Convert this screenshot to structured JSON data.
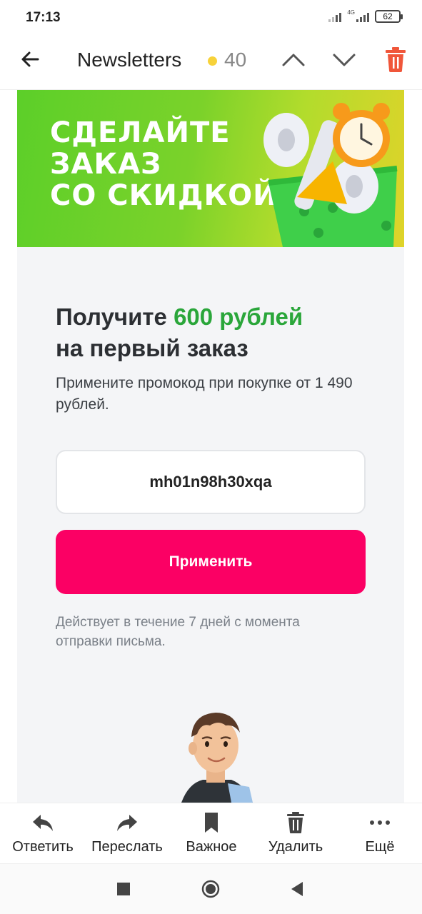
{
  "status_bar": {
    "time": "17:13",
    "network": "4G",
    "battery": "62"
  },
  "header": {
    "title": "Newsletters",
    "unread_count": "40",
    "unread_dot_color": "#f7d23a"
  },
  "banner": {
    "lines": [
      "СДЕЛАЙТЕ",
      "ЗАКАЗ",
      "СО СКИДКОЙ"
    ]
  },
  "promo": {
    "title_prefix": "Получите ",
    "title_accent": "600 рублей",
    "title_suffix": "на первый заказ",
    "description": "Примените промокод при покупке от 1 490 рублей.",
    "code": "mh01n98h30xqa",
    "apply_label": "Применить",
    "validity_note": "Действует в течение 7 дней с момента отправки письма.",
    "accent_color": "#2aa63a",
    "button_color": "#fb0064"
  },
  "actions": [
    {
      "label": "Ответить",
      "icon": "reply-icon"
    },
    {
      "label": "Переслать",
      "icon": "forward-icon"
    },
    {
      "label": "Важное",
      "icon": "bookmark-icon"
    },
    {
      "label": "Удалить",
      "icon": "trash-icon"
    },
    {
      "label": "Ещё",
      "icon": "more-icon"
    }
  ],
  "android_nav": {
    "buttons": [
      "recents-button",
      "home-button",
      "back-button"
    ]
  }
}
